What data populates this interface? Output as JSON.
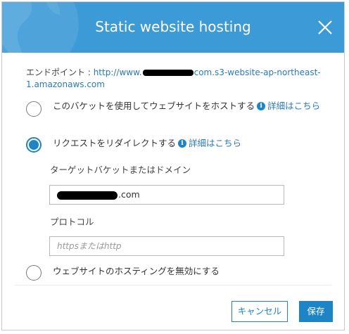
{
  "dialog": {
    "title": "Static website hosting",
    "close_icon": "close-icon"
  },
  "endpoint": {
    "label": "エンドポイント : ",
    "url_prefix": "http://www.",
    "url_suffix": "com.s3-website-ap-northeast-1.amazonaws.com"
  },
  "options": {
    "host": {
      "label": "このバケットを使用してウェブサイトをホストする",
      "learn_more": "詳細はこちら",
      "selected": false
    },
    "redirect": {
      "label": "リクエストをリダイレクトする",
      "learn_more": "詳細はこちら",
      "selected": true
    },
    "disable": {
      "label": "ウェブサイトのホスティングを無効にする",
      "selected": false
    }
  },
  "redirect_form": {
    "target_label": "ターゲットバケットまたはドメイン",
    "target_value_suffix": ".com",
    "protocol_label": "プロトコル",
    "protocol_placeholder": "httpsまたはhttp"
  },
  "buttons": {
    "cancel": "キャンセル",
    "save": "保存"
  },
  "colors": {
    "header": "#3c9ad6",
    "accent": "#1d84c7",
    "link": "#2a7ab8"
  }
}
